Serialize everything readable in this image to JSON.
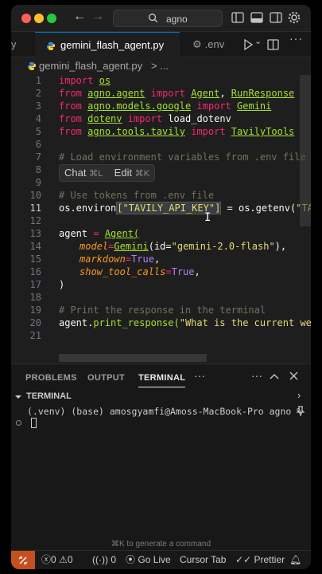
{
  "titlebar": {
    "search_text": "agno",
    "back_arrow": "←",
    "forward_arrow": "→"
  },
  "tabs": [
    {
      "label": "gemini_flash_agent.py"
    },
    {
      "label": ".env"
    }
  ],
  "tab_partial_left": "y",
  "breadcrumb": {
    "file": "gemini_flash_agent.py",
    "rest": "> ..."
  },
  "editor": {
    "line_numbers": [
      "1",
      "2",
      "3",
      "4",
      "5",
      "6",
      "7",
      "8",
      "9",
      "10",
      "11",
      "12",
      "13",
      "14",
      "15",
      "16",
      "17",
      "18",
      "19",
      "20",
      "21"
    ],
    "current_line": "11",
    "lines": {
      "l1": {
        "kw": "import",
        "mod": "os"
      },
      "l2": {
        "kw1": "from",
        "mod": "agno.agent",
        "kw2": "import",
        "a": "Agent",
        "comma": ", ",
        "b": "RunResponse"
      },
      "l3": {
        "kw1": "from",
        "mod": "agno.models.google",
        "kw2": "import",
        "a": "Gemini"
      },
      "l4": {
        "kw1": "from",
        "mod": "dotenv",
        "kw2": "import",
        "a": "load_dotenv"
      },
      "l5": {
        "kw1": "from",
        "mod": "agno.tools.tavily",
        "kw2": "import",
        "a": "TavilyTools"
      },
      "l7": {
        "comment": "# Load environment variables from .env file"
      },
      "l10": {
        "comment": "# Use tokens from .env file"
      },
      "l11": {
        "a": "os.environ",
        "s": "[\"TAVILY_API_KEY\"]",
        "eq": " = ",
        "b": "os.getenv(",
        "s2": "\"TAVILY_"
      },
      "l13": {
        "a": "agent",
        "eq": " = ",
        "b": "Agent("
      },
      "l14": {
        "p": "model",
        "eq": "=",
        "cls": "Gemini",
        "rest": "(id=",
        "s": "\"gemini-2.0-flash\"",
        "end": "),"
      },
      "l15": {
        "p": "markdown",
        "eq": "=",
        "v": "True",
        "end": ","
      },
      "l16": {
        "p": "show_tool_calls",
        "eq": "=",
        "v": "True",
        "end": ","
      },
      "l17": {
        "a": ")"
      },
      "l19": {
        "comment": "# Print the response in the terminal"
      },
      "l20": {
        "a": "agent.",
        "fn": "print_response(",
        "s": "\"What is the current weather"
      }
    },
    "hover_popup": {
      "chat": "Chat",
      "chat_kb": "⌘L",
      "edit": "Edit",
      "edit_kb": "⌘K"
    }
  },
  "panel": {
    "tabs": [
      "PROBLEMS",
      "OUTPUT",
      "TERMINAL"
    ],
    "active_tab": "TERMINAL",
    "more": "···",
    "terminal_header": "TERMINAL",
    "prompt": "(.venv) (base) amosgyamfi@Amoss-MacBook-Pro agno %",
    "cmdk_hint": "⌘K to generate a command"
  },
  "statusbar": {
    "errors": "0",
    "warnings": "0",
    "ports": "0",
    "go_live": "Go Live",
    "cursor_tab": "Cursor Tab",
    "prettier": "Prettier"
  },
  "colors": {
    "accent": "#0078d4",
    "remote": "#c5501f"
  }
}
